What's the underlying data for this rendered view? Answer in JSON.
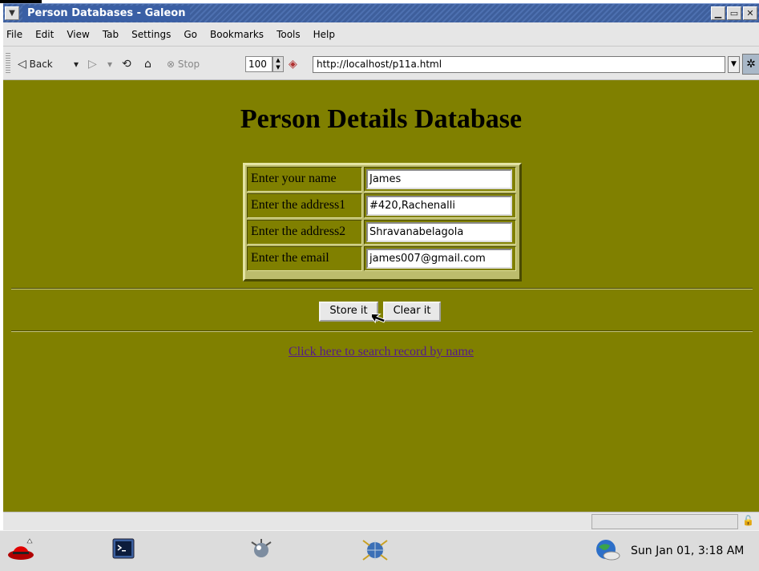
{
  "window": {
    "title": "Person Databases - Galeon"
  },
  "menubar": {
    "items": [
      "File",
      "Edit",
      "View",
      "Tab",
      "Settings",
      "Go",
      "Bookmarks",
      "Tools",
      "Help"
    ]
  },
  "toolbar": {
    "back_label": "Back",
    "stop_label": "Stop",
    "zoom_value": "100",
    "url": "http://localhost/p11a.html",
    "icons": [
      "back-arrow-icon",
      "forward-arrow-icon",
      "reload-icon",
      "home-icon",
      "stop-icon",
      "zoom-spin-icon",
      "galeon-icon",
      "throbber-icon"
    ]
  },
  "page": {
    "title": "Person Details Database",
    "form": {
      "rows": [
        {
          "label": "Enter your name",
          "value": "James"
        },
        {
          "label": "Enter the address1",
          "value": "#420,Rachenalli"
        },
        {
          "label": "Enter the address2",
          "value": "Shravanabelagola"
        },
        {
          "label": "Enter the email",
          "value": "james007@gmail.com"
        }
      ]
    },
    "store_button": "Store it",
    "clear_button": "Clear it",
    "search_link": "Click here to search record by name"
  },
  "colors": {
    "page_background": "#808000",
    "link": "#551a8b"
  },
  "taskbar": {
    "clock": "Sun Jan 01,  3:18 AM",
    "icons": [
      "redhat-icon",
      "terminal-icon",
      "galeon-launcher-icon",
      "network-icon",
      "globe-icon"
    ]
  }
}
